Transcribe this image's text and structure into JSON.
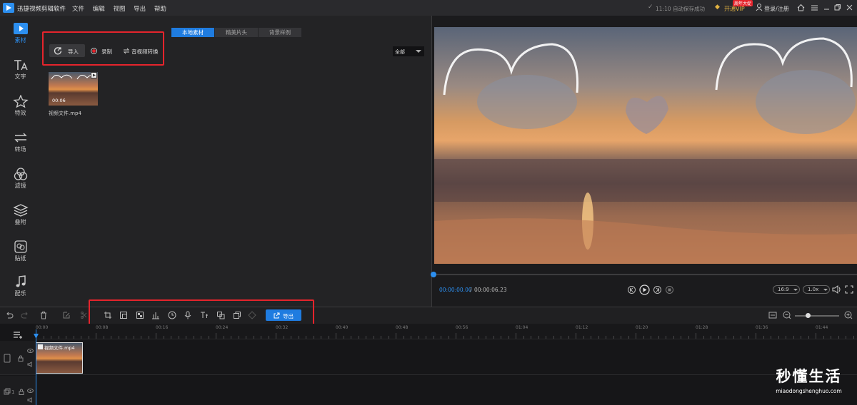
{
  "app": {
    "title": "迅捷视频剪辑软件"
  },
  "menu": [
    "文件",
    "编辑",
    "视图",
    "导出",
    "帮助"
  ],
  "status": {
    "autosave": "11:10 自动保存成功",
    "vip": "开通VIP",
    "vip_badge": "周年大促",
    "login": "登录/注册"
  },
  "nav": [
    {
      "label": "素材",
      "icon": "media-icon"
    },
    {
      "label": "文字",
      "icon": "text-icon"
    },
    {
      "label": "特效",
      "icon": "effects-icon"
    },
    {
      "label": "转场",
      "icon": "transition-icon"
    },
    {
      "label": "滤镜",
      "icon": "filter-icon"
    },
    {
      "label": "叠附",
      "icon": "overlay-icon"
    },
    {
      "label": "贴纸",
      "icon": "sticker-icon"
    },
    {
      "label": "配乐",
      "icon": "music-icon"
    }
  ],
  "media": {
    "tabs": [
      "本地素材",
      "精美片头",
      "背景样例"
    ],
    "import": "导入",
    "record": "录制",
    "convert": "音视频转换",
    "filter": "全部",
    "item": {
      "name": "视频文件.mp4",
      "duration": "00:06"
    }
  },
  "preview": {
    "time_current": "00:00:00.00",
    "time_separator": "/",
    "time_total": "00:00:06.23",
    "ratio": "16:9",
    "speed": "1.0x"
  },
  "toolbar": {
    "export": "导出"
  },
  "timeline": {
    "ticks": [
      "00:00",
      "00:08",
      "00:16",
      "00:24",
      "00:32",
      "00:40",
      "00:48",
      "00:56",
      "01:04",
      "01:12",
      "01:20",
      "01:28",
      "01:36",
      "01:44"
    ],
    "clip_name": "视频文件.mp4",
    "track2_num": "1"
  },
  "watermark": {
    "title": "秒懂生活",
    "url": "miaodongshenghuo.com"
  },
  "colors": {
    "accent": "#1f7ce0",
    "highlight": "#e5242c",
    "vip": "#e3b341"
  }
}
